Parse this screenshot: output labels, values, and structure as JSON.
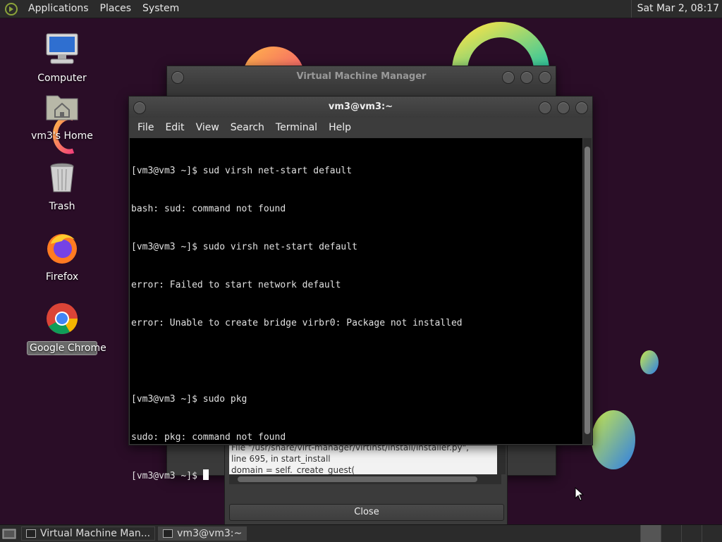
{
  "panel": {
    "menus": [
      "Applications",
      "Places",
      "System"
    ],
    "clock": "Sat Mar  2, 08:17"
  },
  "desktop": {
    "icons": [
      {
        "label": "Computer"
      },
      {
        "label": "vm3's Home"
      },
      {
        "label": "Trash"
      },
      {
        "label": "Firefox"
      },
      {
        "label": "Google Chrome"
      }
    ]
  },
  "vmm_window": {
    "title": "Virtual Machine Manager",
    "traceback_lines": [
      "File \"/usr/share/virt-manager/virtinst/install/installer.py\",",
      "line 695, in start_install",
      "    domain = self._create_guest("
    ],
    "close_label": "Close"
  },
  "terminal": {
    "title": "vm3@vm3:~",
    "menus": [
      "File",
      "Edit",
      "View",
      "Search",
      "Terminal",
      "Help"
    ],
    "lines": [
      "[vm3@vm3 ~]$ sud virsh net-start default",
      "bash: sud: command not found",
      "[vm3@vm3 ~]$ sudo virsh net-start default",
      "error: Failed to start network default",
      "error: Unable to create bridge virbr0: Package not installed",
      "",
      "[vm3@vm3 ~]$ sudo pkg",
      "sudo: pkg: command not found"
    ],
    "prompt": "[vm3@vm3 ~]$ "
  },
  "taskbar": {
    "tasks": [
      {
        "label": "Virtual Machine Man..."
      },
      {
        "label": "vm3@vm3:~"
      }
    ]
  },
  "colors": {
    "desktop_bg": "#2a0d27",
    "panel_bg": "#2b2b2b",
    "terminal_bg": "#000000"
  }
}
